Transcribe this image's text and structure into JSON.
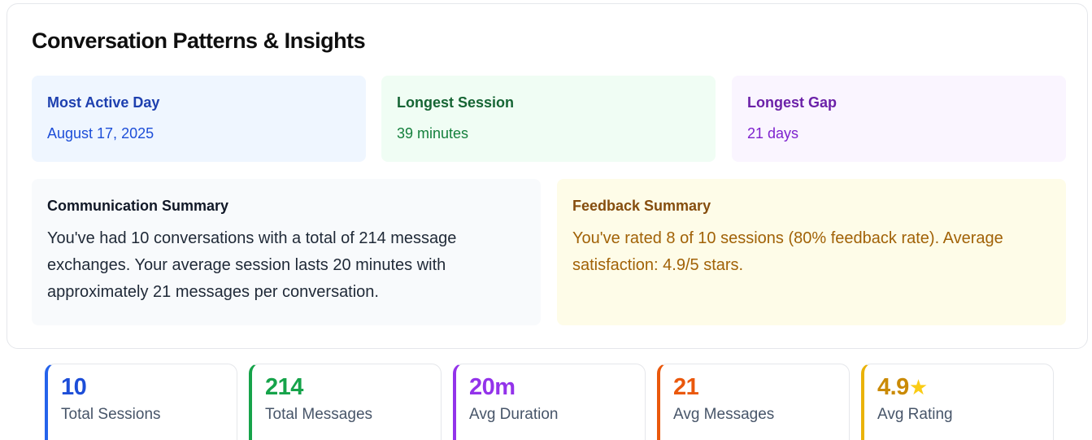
{
  "insights": {
    "title": "Conversation Patterns & Insights",
    "most_active_day": {
      "label": "Most Active Day",
      "value": "August 17, 2025"
    },
    "longest_session": {
      "label": "Longest Session",
      "value": "39 minutes"
    },
    "longest_gap": {
      "label": "Longest Gap",
      "value": "21 days"
    },
    "communication_summary": {
      "label": "Communication Summary",
      "text": "You've had 10 conversations with a total of 214 message exchanges. Your average session lasts 20 minutes with approximately 21 messages per conversation."
    },
    "feedback_summary": {
      "label": "Feedback Summary",
      "text": "You've rated 8 of 10 sessions (80% feedback rate). Average satisfaction: 4.9/5 stars."
    }
  },
  "stats": [
    {
      "value": "10",
      "label": "Total Sessions",
      "color": "#2563eb"
    },
    {
      "value": "214",
      "label": "Total Messages",
      "color": "#16a34a"
    },
    {
      "value": "20m",
      "label": "Avg Duration",
      "color": "#9333ea"
    },
    {
      "value": "21",
      "label": "Avg Messages",
      "color": "#ea580c"
    },
    {
      "value": "4.9",
      "label": "Avg Rating",
      "color": "#eab308",
      "icon": "star-icon"
    }
  ]
}
